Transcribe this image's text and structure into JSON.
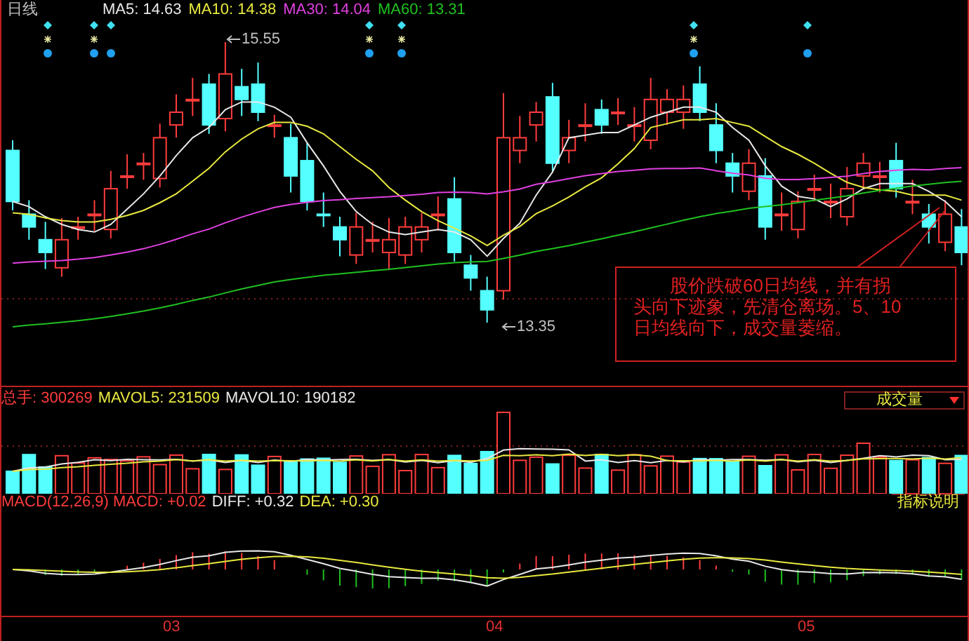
{
  "price_panel": {
    "period": "日线",
    "ma_labels": [
      {
        "label": "MA5: 14.63",
        "color": "#e8e8e8"
      },
      {
        "label": "MA10: 14.38",
        "color": "#e8e840"
      },
      {
        "label": "MA30: 14.04",
        "color": "#e040e0"
      },
      {
        "label": "MA60: 13.31",
        "color": "#20c020"
      }
    ],
    "high_mark": "15.55",
    "low_mark": "13.35",
    "annotation": "股价跌破60日均线，并有拐头向下迹象，先清仓离场。5、10日均线向下，成交量萎缩。"
  },
  "volume_panel": {
    "labels": [
      {
        "label": "总手: 300269",
        "color": "#ff3c3c"
      },
      {
        "label": "MAVOL5: 231509",
        "color": "#e8e840"
      },
      {
        "label": "MAVOL10: 190182",
        "color": "#e8e8e8"
      }
    ],
    "indicator_select": "成交量",
    "help_button": "指标说明"
  },
  "macd_panel": {
    "labels": [
      {
        "label": "MACD(12,26,9) MACD: +0.02",
        "color": "#ff3c3c"
      },
      {
        "label": "DIFF: +0.32",
        "color": "#e8e8e8"
      },
      {
        "label": "DEA: +0.30",
        "color": "#e8e840"
      }
    ]
  },
  "x_axis": [
    "03",
    "04",
    "05"
  ]
}
